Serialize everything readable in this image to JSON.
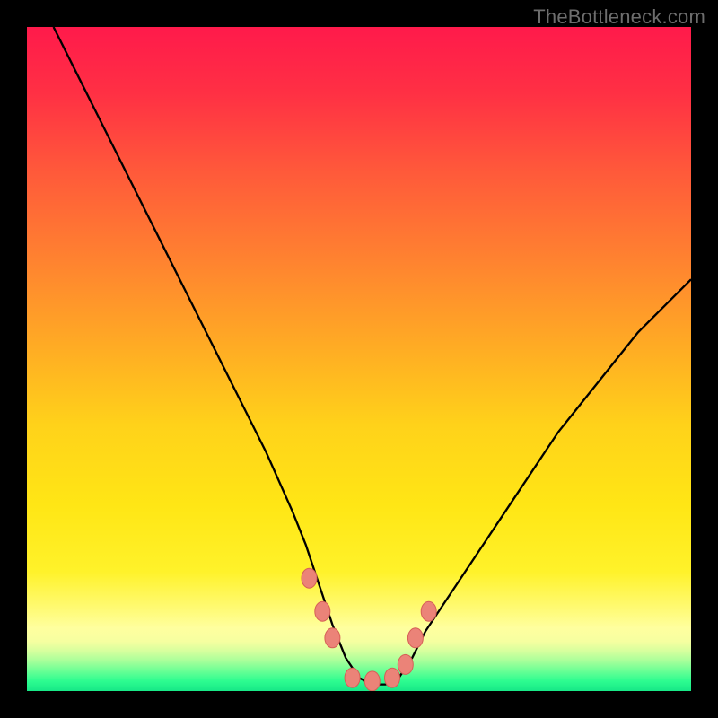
{
  "watermark": "TheBottleneck.com",
  "colors": {
    "frame": "#000000",
    "curve": "#000000",
    "marker_fill": "#eb8378",
    "marker_stroke": "#d65f57",
    "gradient_stops": [
      {
        "offset": 0.0,
        "color": "#ff1a4b"
      },
      {
        "offset": 0.1,
        "color": "#ff3044"
      },
      {
        "offset": 0.22,
        "color": "#ff5a3a"
      },
      {
        "offset": 0.35,
        "color": "#ff8230"
      },
      {
        "offset": 0.48,
        "color": "#ffab24"
      },
      {
        "offset": 0.6,
        "color": "#ffd21a"
      },
      {
        "offset": 0.72,
        "color": "#ffe615"
      },
      {
        "offset": 0.82,
        "color": "#fff22a"
      },
      {
        "offset": 0.88,
        "color": "#fffb7a"
      },
      {
        "offset": 0.905,
        "color": "#ffff9f"
      },
      {
        "offset": 0.925,
        "color": "#f6ffa0"
      },
      {
        "offset": 0.94,
        "color": "#d6ff9e"
      },
      {
        "offset": 0.955,
        "color": "#a6ff9a"
      },
      {
        "offset": 0.97,
        "color": "#68ff95"
      },
      {
        "offset": 0.985,
        "color": "#2dfc90"
      },
      {
        "offset": 1.0,
        "color": "#17e887"
      }
    ]
  },
  "chart_data": {
    "type": "line",
    "title": "",
    "xlabel": "",
    "ylabel": "",
    "xlim": [
      0,
      100
    ],
    "ylim": [
      0,
      100
    ],
    "series": [
      {
        "name": "bottleneck-curve",
        "x": [
          4,
          8,
          12,
          16,
          20,
          24,
          28,
          32,
          36,
          40,
          42,
          44,
          46,
          48,
          50,
          52,
          54,
          56,
          58,
          60,
          64,
          68,
          72,
          76,
          80,
          84,
          88,
          92,
          96,
          100
        ],
        "y": [
          100,
          92,
          84,
          76,
          68,
          60,
          52,
          44,
          36,
          27,
          22,
          16,
          10,
          5,
          2,
          1,
          1,
          2,
          5,
          9,
          15,
          21,
          27,
          33,
          39,
          44,
          49,
          54,
          58,
          62
        ]
      }
    ],
    "markers": {
      "name": "highlight-points",
      "x": [
        42.5,
        44.5,
        46.0,
        49.0,
        52.0,
        55.0,
        57.0,
        58.5,
        60.5
      ],
      "y": [
        17.0,
        12.0,
        8.0,
        2.0,
        1.5,
        2.0,
        4.0,
        8.0,
        12.0
      ]
    }
  }
}
